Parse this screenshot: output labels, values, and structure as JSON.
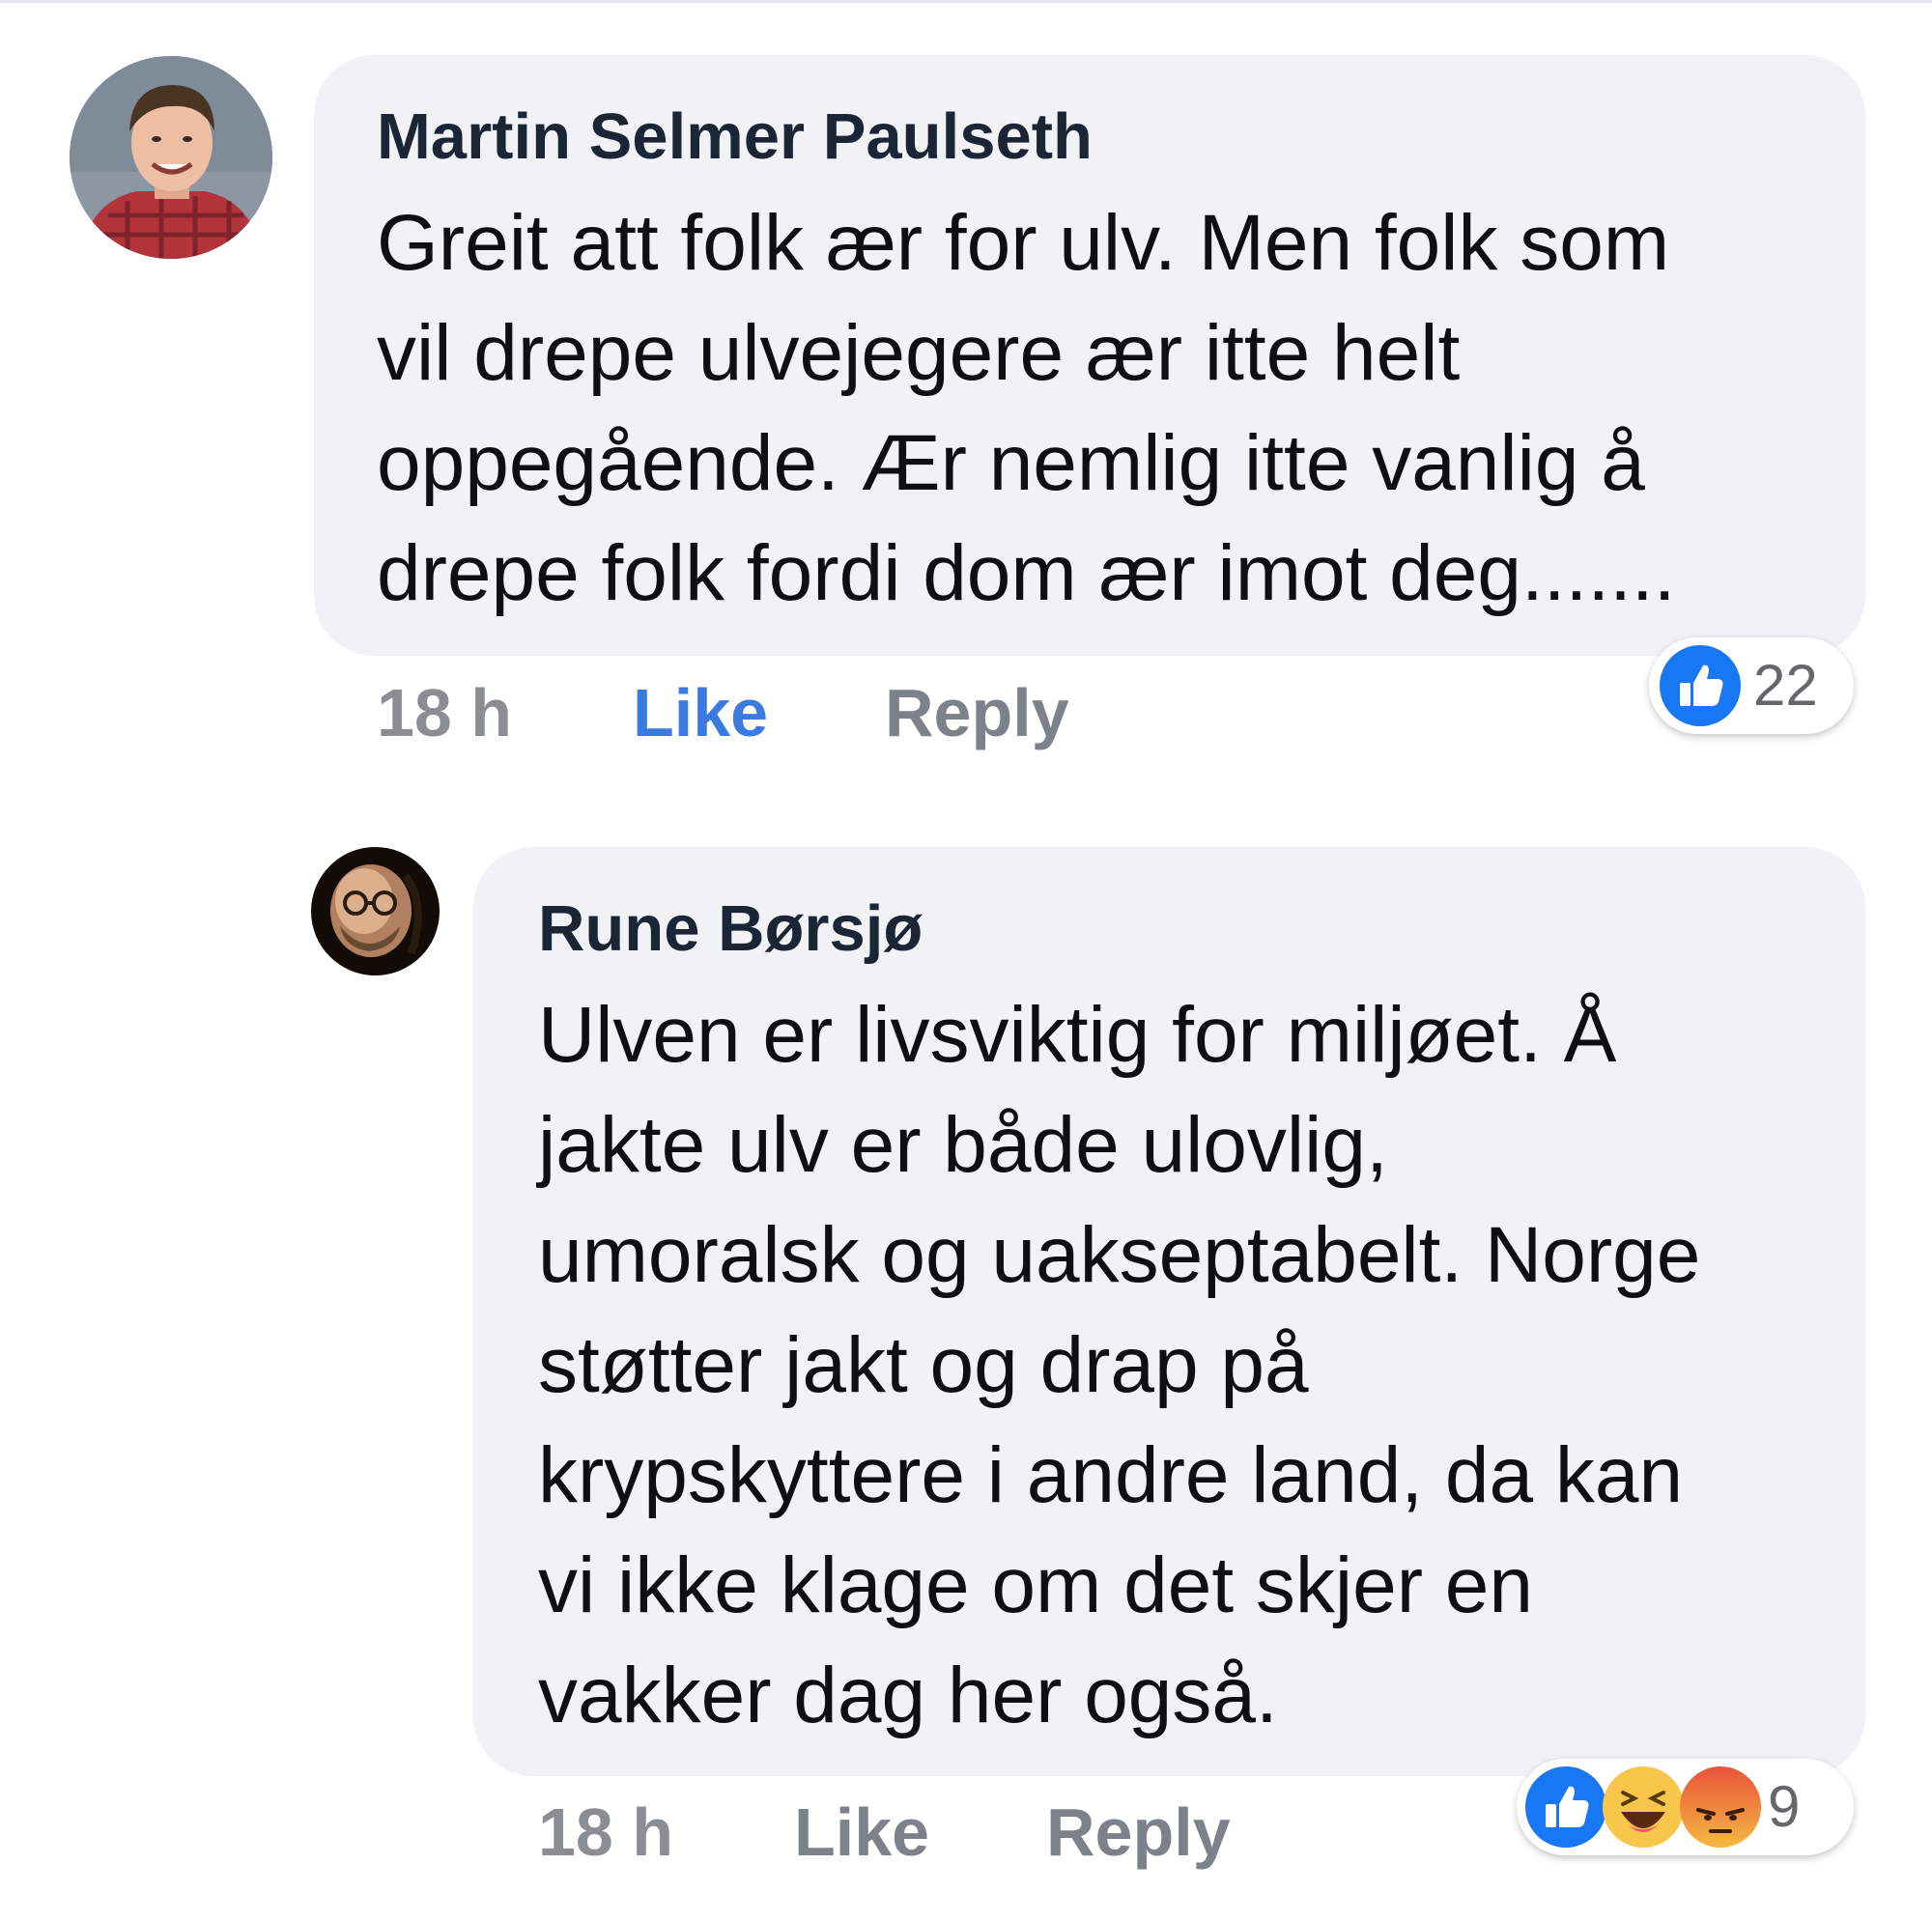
{
  "comments": [
    {
      "author": "Martin Selmer Paulseth",
      "text_lines": [
        "Greit att folk ær for ulv. Men folk som",
        "vil drepe ulvejegere ær itte helt",
        "oppegående. Ær nemlig itte vanlig å",
        "drepe folk fordi dom ær imot deg......."
      ],
      "time": "18 h",
      "like_label": "Like",
      "reply_label": "Reply",
      "liked": true,
      "reactions": [
        "like-icon"
      ],
      "reaction_count": "22"
    },
    {
      "author": "Rune Børsjø",
      "text_lines": [
        "Ulven er livsviktig for miljøet. Å",
        "jakte ulv er både ulovlig,",
        "umoralsk og uakseptabelt. Norge",
        "støtter jakt og drap på",
        "krypskyttere i andre land, da kan",
        "vi ikke klage om det skjer en",
        "vakker dag her også."
      ],
      "time": "18 h",
      "like_label": "Like",
      "reply_label": "Reply",
      "liked": false,
      "reactions": [
        "like-icon",
        "haha-icon",
        "angry-icon"
      ],
      "reaction_count": "9"
    }
  ],
  "colors": {
    "bubble": "#f0f2f5",
    "like_active": "#3b7be0",
    "like_reaction": "#1877f2",
    "action_text": "#7c818a",
    "author_text": "#1c2536"
  }
}
